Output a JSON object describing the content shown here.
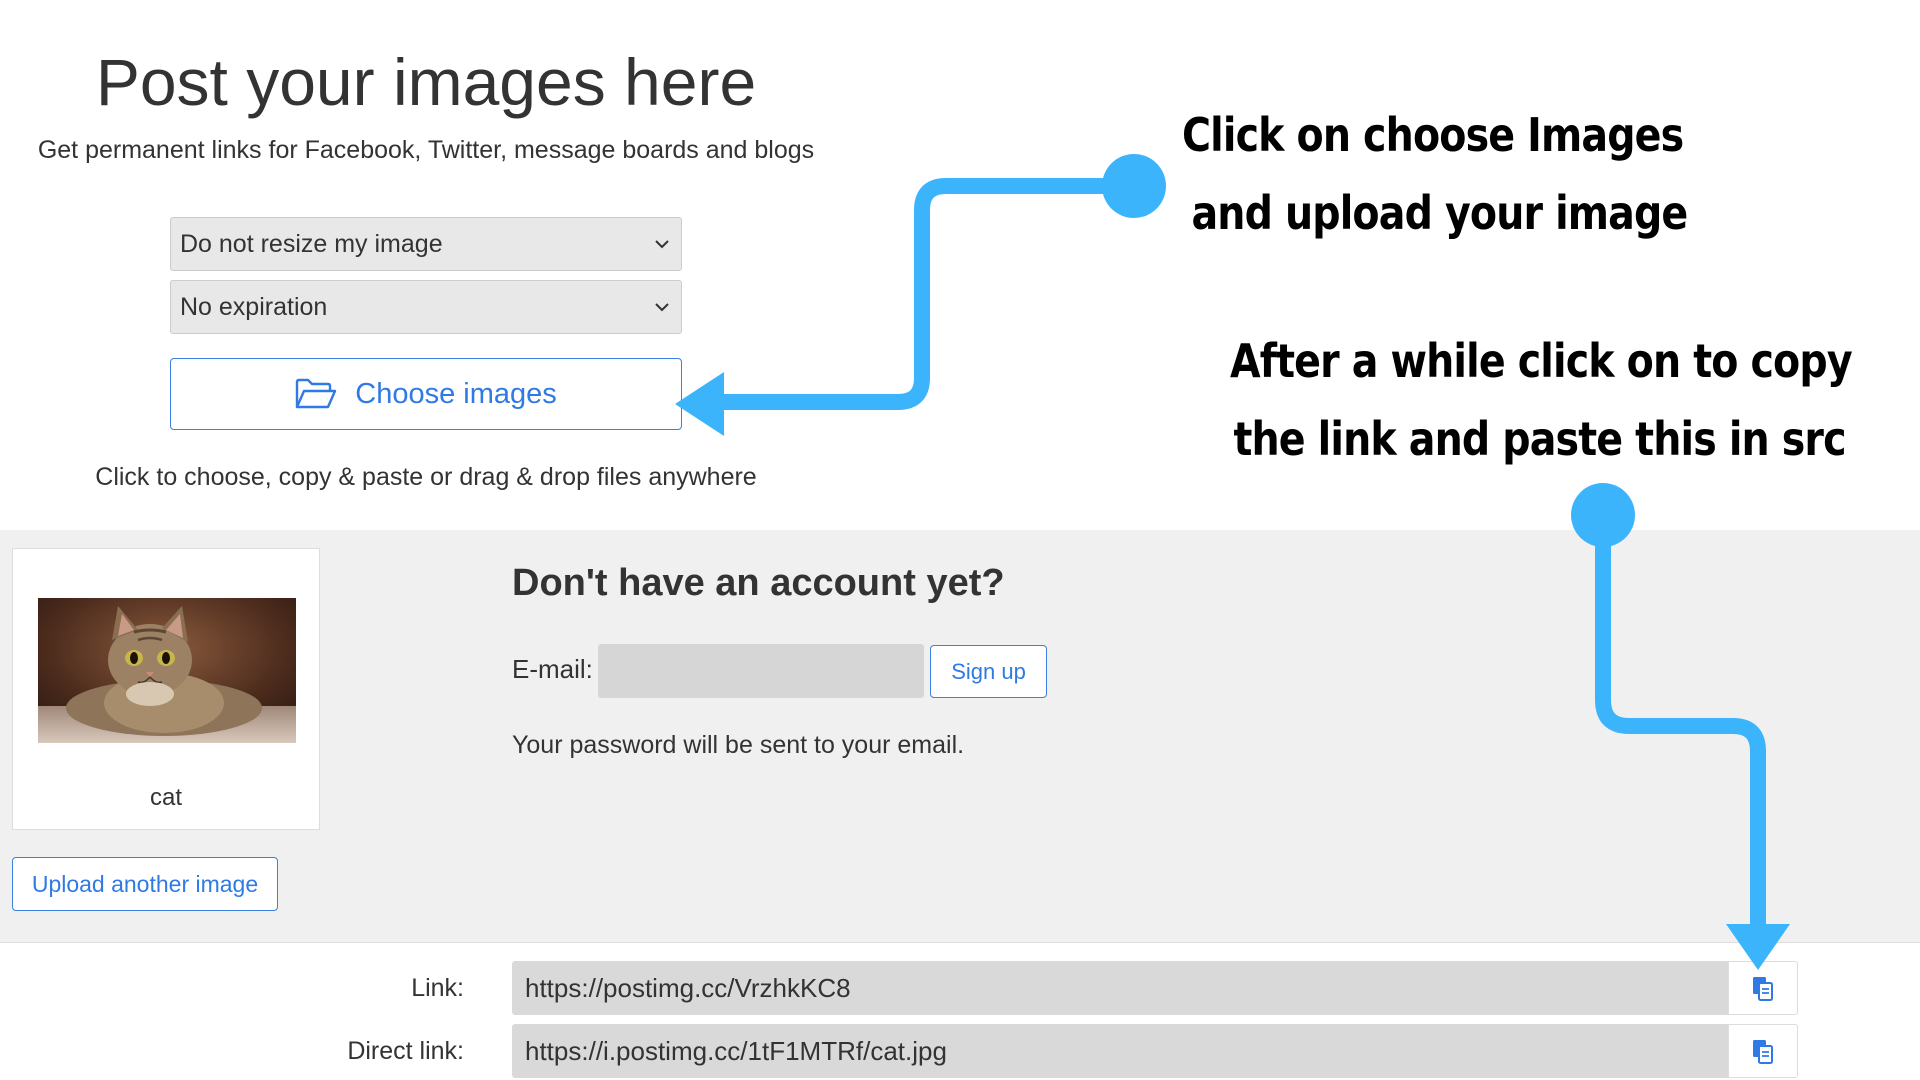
{
  "upload": {
    "title": "Post your images here",
    "subtitle": "Get permanent links for Facebook, Twitter, message boards and blogs",
    "resize_select": "Do not resize my image",
    "expiration_select": "No expiration",
    "choose_button": "Choose images",
    "hint": "Click to choose, copy & paste or drag & drop files anywhere"
  },
  "uploaded_image": {
    "caption": "cat",
    "upload_another_button": "Upload another image"
  },
  "account": {
    "heading": "Don't have an account yet?",
    "email_label": "E-mail:",
    "email_value": "",
    "signup_button": "Sign up",
    "password_note": "Your password will be sent to your email."
  },
  "links": [
    {
      "label": "Link:",
      "value": "https://postimg.cc/VrzhkKC8"
    },
    {
      "label": "Direct link:",
      "value": "https://i.postimg.cc/1tF1MTRf/cat.jpg"
    }
  ],
  "annotations": {
    "step1_line1": "Click on choose Images",
    "step1_line2": "and upload your image",
    "step2_line1": "After a while click on to copy",
    "step2_line2": "the link and paste this in src"
  },
  "colors": {
    "accent_blue": "#2f7ae5",
    "arrow_blue": "#3bb4fb",
    "field_grey": "#d9d9d9",
    "band_grey": "#f0f0f0"
  },
  "icons": {
    "choose": "folder-open-icon",
    "select_caret": "chevron-down-icon",
    "copy": "copy-icon"
  }
}
